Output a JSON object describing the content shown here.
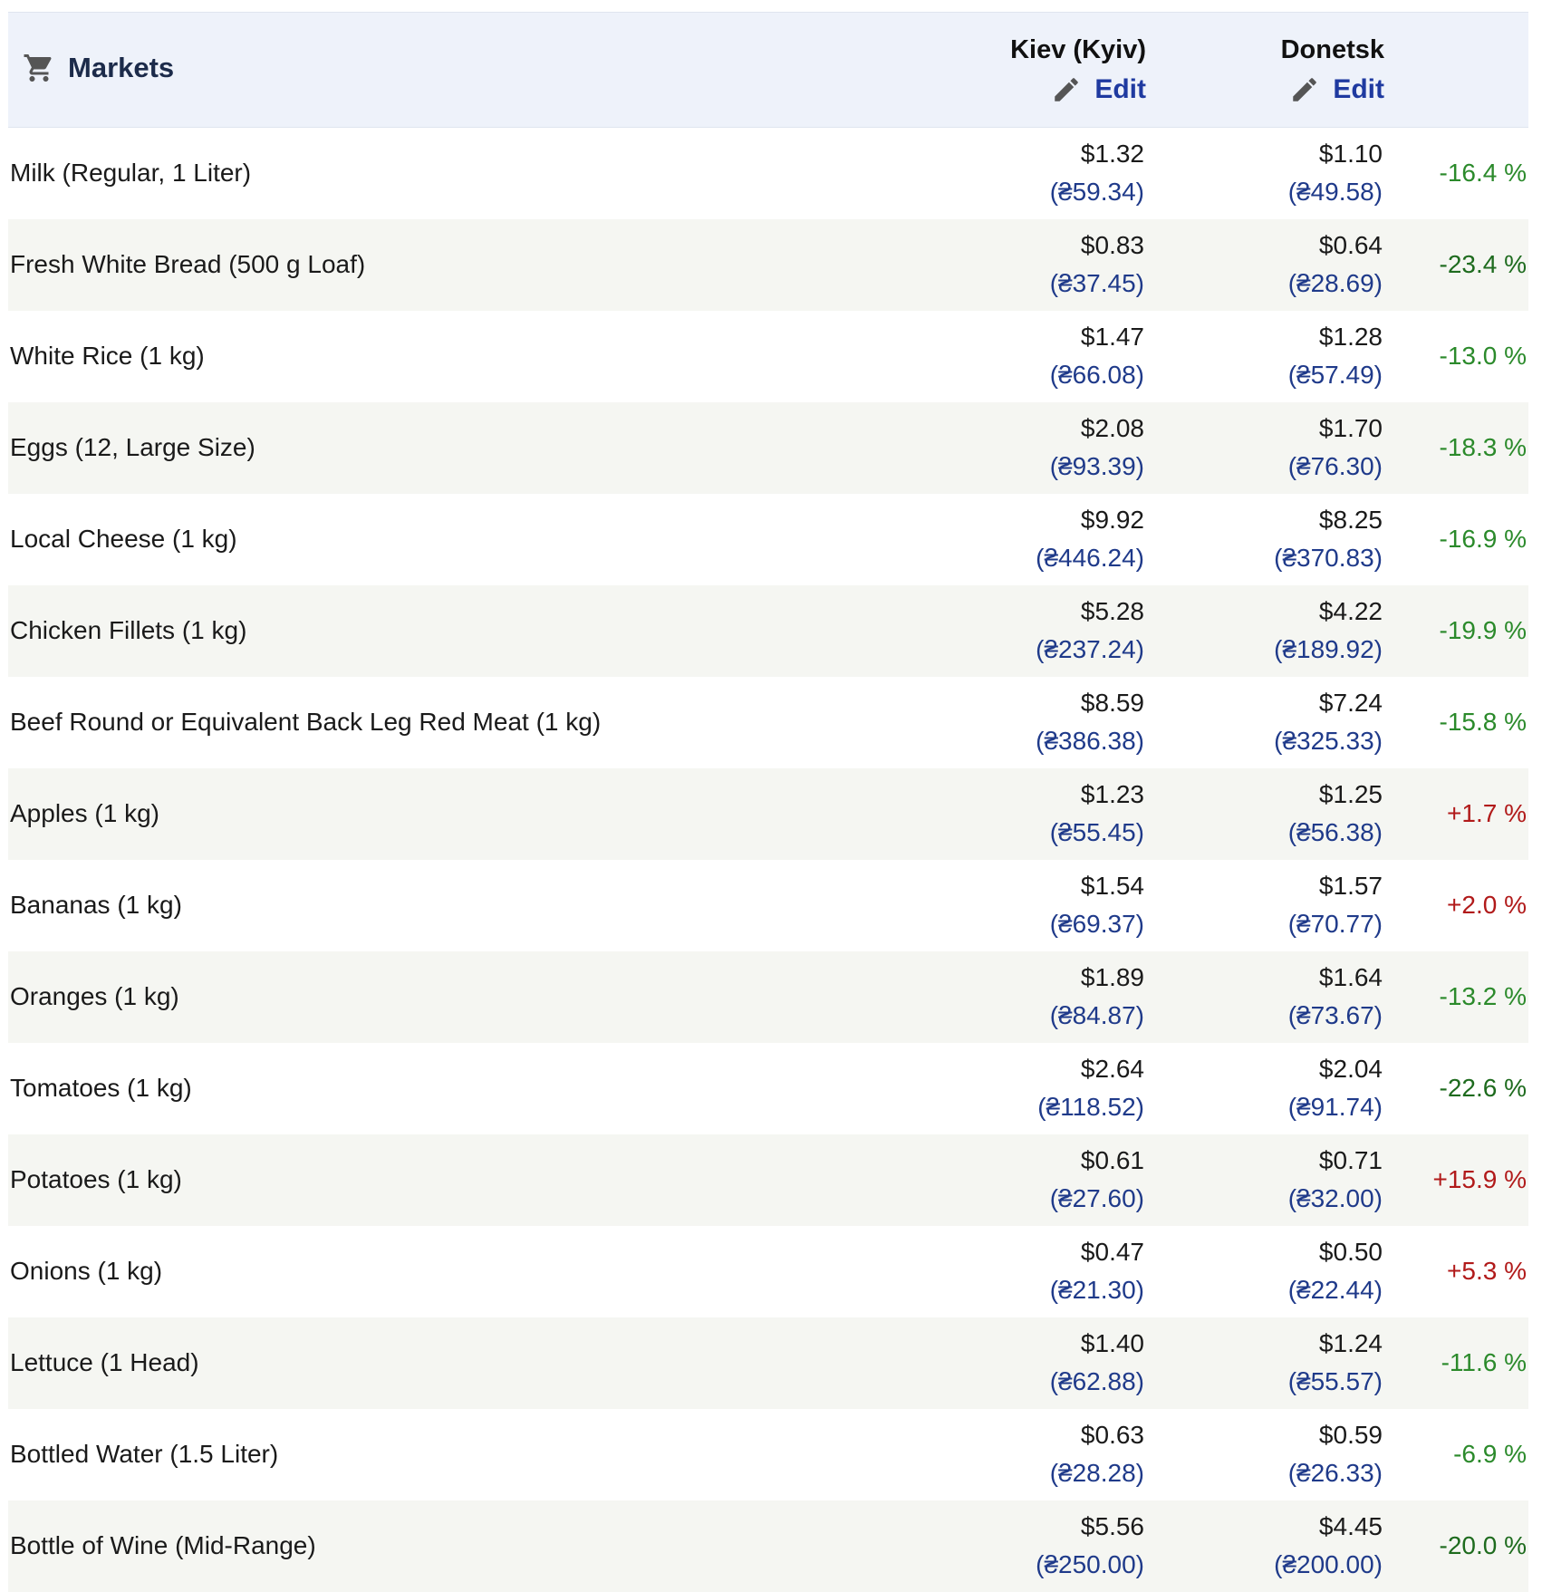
{
  "header": {
    "title": "Markets",
    "cities": [
      {
        "name": "Kiev (Kyiv)",
        "edit_label": "Edit"
      },
      {
        "name": "Donetsk",
        "edit_label": "Edit"
      }
    ]
  },
  "colors": {
    "header_bg": "#eef2fa",
    "row_alt_bg": "#f5f6f2",
    "link": "#1f3aa0",
    "local_price": "#1f3a8a",
    "decrease": "#2b8a2b",
    "increase": "#b11a1a"
  },
  "icons": {
    "header": "cart-icon",
    "edit": "pencil-icon"
  },
  "rows": [
    {
      "item": "Milk (Regular, 1 Liter)",
      "kiev_usd": "$1.32",
      "kiev_local": "(₴59.34)",
      "donetsk_usd": "$1.10",
      "donetsk_local": "(₴49.58)",
      "diff": "-16.4 %",
      "trend": "neg"
    },
    {
      "item": "Fresh White Bread (500 g Loaf)",
      "kiev_usd": "$0.83",
      "kiev_local": "(₴37.45)",
      "donetsk_usd": "$0.64",
      "donetsk_local": "(₴28.69)",
      "diff": "-23.4 %",
      "trend": "neg-strong"
    },
    {
      "item": "White Rice (1 kg)",
      "kiev_usd": "$1.47",
      "kiev_local": "(₴66.08)",
      "donetsk_usd": "$1.28",
      "donetsk_local": "(₴57.49)",
      "diff": "-13.0 %",
      "trend": "neg"
    },
    {
      "item": "Eggs (12, Large Size)",
      "kiev_usd": "$2.08",
      "kiev_local": "(₴93.39)",
      "donetsk_usd": "$1.70",
      "donetsk_local": "(₴76.30)",
      "diff": "-18.3 %",
      "trend": "neg"
    },
    {
      "item": "Local Cheese (1 kg)",
      "kiev_usd": "$9.92",
      "kiev_local": "(₴446.24)",
      "donetsk_usd": "$8.25",
      "donetsk_local": "(₴370.83)",
      "diff": "-16.9 %",
      "trend": "neg"
    },
    {
      "item": "Chicken Fillets (1 kg)",
      "kiev_usd": "$5.28",
      "kiev_local": "(₴237.24)",
      "donetsk_usd": "$4.22",
      "donetsk_local": "(₴189.92)",
      "diff": "-19.9 %",
      "trend": "neg"
    },
    {
      "item": "Beef Round or Equivalent Back Leg Red Meat (1 kg)",
      "kiev_usd": "$8.59",
      "kiev_local": "(₴386.38)",
      "donetsk_usd": "$7.24",
      "donetsk_local": "(₴325.33)",
      "diff": "-15.8 %",
      "trend": "neg"
    },
    {
      "item": "Apples (1 kg)",
      "kiev_usd": "$1.23",
      "kiev_local": "(₴55.45)",
      "donetsk_usd": "$1.25",
      "donetsk_local": "(₴56.38)",
      "diff": "+1.7 %",
      "trend": "pos"
    },
    {
      "item": "Bananas (1 kg)",
      "kiev_usd": "$1.54",
      "kiev_local": "(₴69.37)",
      "donetsk_usd": "$1.57",
      "donetsk_local": "(₴70.77)",
      "diff": "+2.0 %",
      "trend": "pos"
    },
    {
      "item": "Oranges (1 kg)",
      "kiev_usd": "$1.89",
      "kiev_local": "(₴84.87)",
      "donetsk_usd": "$1.64",
      "donetsk_local": "(₴73.67)",
      "diff": "-13.2 %",
      "trend": "neg"
    },
    {
      "item": "Tomatoes (1 kg)",
      "kiev_usd": "$2.64",
      "kiev_local": "(₴118.52)",
      "donetsk_usd": "$2.04",
      "donetsk_local": "(₴91.74)",
      "diff": "-22.6 %",
      "trend": "neg-strong"
    },
    {
      "item": "Potatoes (1 kg)",
      "kiev_usd": "$0.61",
      "kiev_local": "(₴27.60)",
      "donetsk_usd": "$0.71",
      "donetsk_local": "(₴32.00)",
      "diff": "+15.9 %",
      "trend": "pos"
    },
    {
      "item": "Onions (1 kg)",
      "kiev_usd": "$0.47",
      "kiev_local": "(₴21.30)",
      "donetsk_usd": "$0.50",
      "donetsk_local": "(₴22.44)",
      "diff": "+5.3 %",
      "trend": "pos"
    },
    {
      "item": "Lettuce (1 Head)",
      "kiev_usd": "$1.40",
      "kiev_local": "(₴62.88)",
      "donetsk_usd": "$1.24",
      "donetsk_local": "(₴55.57)",
      "diff": "-11.6 %",
      "trend": "neg"
    },
    {
      "item": "Bottled Water (1.5 Liter)",
      "kiev_usd": "$0.63",
      "kiev_local": "(₴28.28)",
      "donetsk_usd": "$0.59",
      "donetsk_local": "(₴26.33)",
      "diff": "-6.9 %",
      "trend": "neg"
    },
    {
      "item": "Bottle of Wine (Mid-Range)",
      "kiev_usd": "$5.56",
      "kiev_local": "(₴250.00)",
      "donetsk_usd": "$4.45",
      "donetsk_local": "(₴200.00)",
      "diff": "-20.0 %",
      "trend": "neg-strong"
    }
  ]
}
